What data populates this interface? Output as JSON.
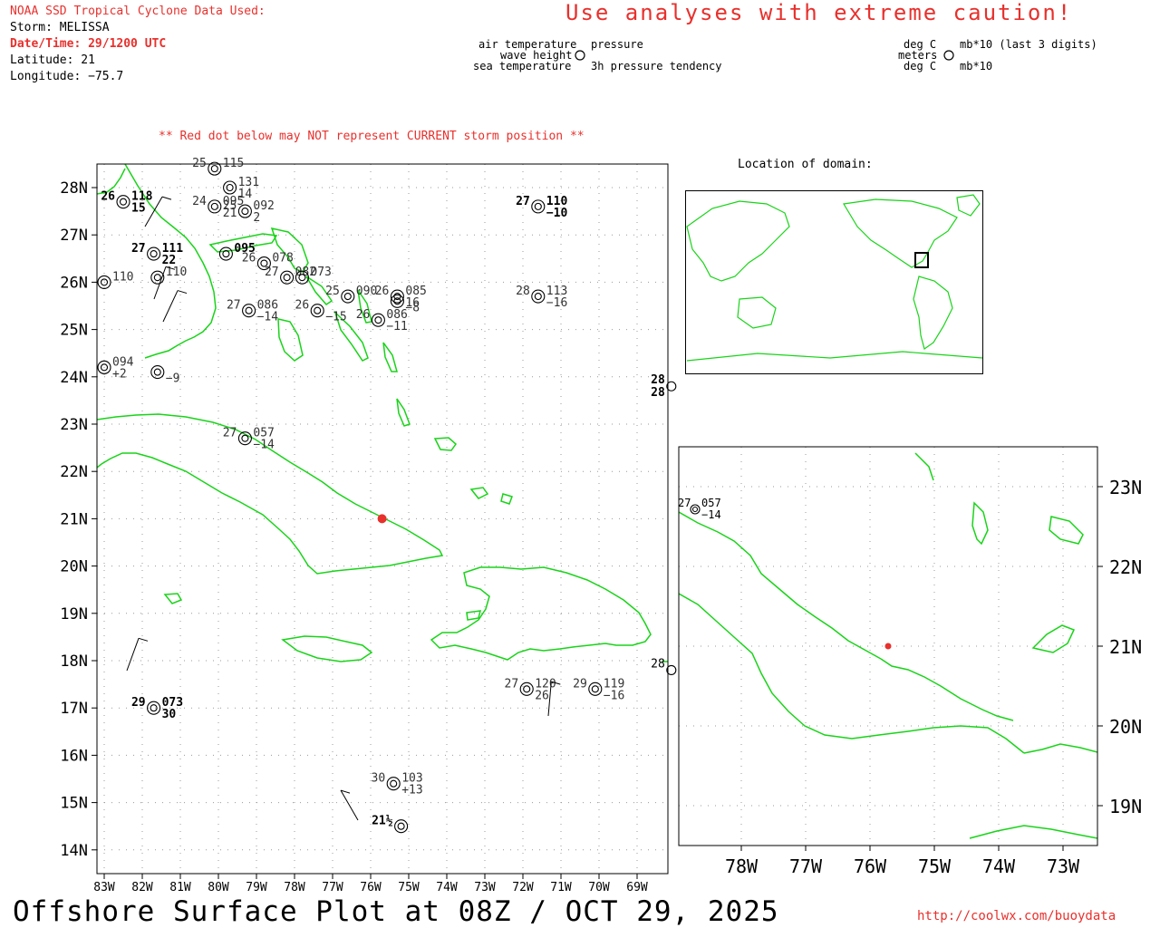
{
  "header": {
    "source": "NOAA SSD Tropical Cyclone Data Used:",
    "storm": "Storm: MELISSA",
    "datetime": "Date/Time: 29/1200 UTC",
    "latitude": "Latitude: 21",
    "longitude": "Longitude: −75.7",
    "caution": "Use analyses with extreme caution!",
    "red_dot_note": "** Red dot below may NOT represent CURRENT storm position **"
  },
  "legend": {
    "left": [
      "air temperature",
      "wave height",
      "sea temperature"
    ],
    "right": [
      "pressure",
      "3h pressure tendency"
    ],
    "units_left": [
      "deg C",
      "meters",
      "deg C"
    ],
    "units_right": [
      "mb*10 (last 3 digits)",
      "mb*10"
    ]
  },
  "main_map": {
    "lat_labels": [
      "28N",
      "27N",
      "26N",
      "25N",
      "24N",
      "23N",
      "22N",
      "21N",
      "20N",
      "19N",
      "18N",
      "17N",
      "16N",
      "15N",
      "14N"
    ],
    "lon_labels": [
      "83W",
      "82W",
      "81W",
      "80W",
      "79W",
      "78W",
      "77W",
      "76W",
      "75W",
      "74W",
      "73W",
      "72W",
      "71W",
      "70W",
      "69W"
    ],
    "stations": [
      {
        "lon": -71.6,
        "lat": 27.6,
        "t": "27",
        "p": "110",
        "tend": "−10",
        "bold": true
      },
      {
        "lon": -71.6,
        "lat": 25.7,
        "t": "28",
        "p": "113",
        "tend": "−16"
      },
      {
        "lon": -75.8,
        "lat": 25.2,
        "t": "26",
        "p": "086",
        "tend": "−11"
      },
      {
        "lon": -77.4,
        "lat": 25.4,
        "t": "26",
        "p": "",
        "tend": "−15"
      },
      {
        "lon": -79.2,
        "lat": 25.4,
        "t": "27",
        "p": "086",
        "tend": "−14"
      },
      {
        "lon": -79.3,
        "lat": 22.7,
        "t": "27",
        "p": "057",
        "tend": "−14"
      },
      {
        "lon": -70.1,
        "lat": 17.4,
        "t": "29",
        "p": "119",
        "tend": "−16"
      },
      {
        "lon": -71.9,
        "lat": 17.4,
        "t": "27",
        "p": "120",
        "tend": "26"
      },
      {
        "lon": -75.4,
        "lat": 15.4,
        "t": "30",
        "p": "103",
        "tend": "+13"
      },
      {
        "lon": -75.2,
        "lat": 14.5,
        "t": "21½",
        "p": "",
        "tend": "",
        "bold": true
      },
      {
        "lon": -81.7,
        "lat": 17.0,
        "t": "29",
        "p": "073",
        "tend": "30",
        "bold": true
      },
      {
        "lon": -83.0,
        "lat": 26.0,
        "t": "",
        "p": "110",
        "tend": ""
      },
      {
        "lon": -83.0,
        "lat": 24.2,
        "t": "",
        "p": "094",
        "tend": "+2"
      },
      {
        "lon": -81.6,
        "lat": 24.1,
        "t": "",
        "p": "",
        "tend": "−9"
      },
      {
        "lon": -81.7,
        "lat": 26.6,
        "t": "27",
        "p": "111",
        "tend": "22",
        "bold": true
      },
      {
        "lon": -81.6,
        "lat": 26.1,
        "t": "",
        "p": "110",
        "tend": ""
      },
      {
        "lon": -80.1,
        "lat": 27.6,
        "t": "24",
        "p": "095",
        "tend": "21"
      },
      {
        "lon": -79.3,
        "lat": 27.5,
        "t": "25",
        "p": "092",
        "tend": "2"
      },
      {
        "lon": -79.8,
        "lat": 26.6,
        "t": "",
        "p": "095",
        "tend": "",
        "bold": true
      },
      {
        "lon": -78.8,
        "lat": 26.4,
        "t": "26",
        "p": "078",
        "tend": ""
      },
      {
        "lon": -78.2,
        "lat": 26.1,
        "t": "27",
        "p": "082",
        "tend": ""
      },
      {
        "lon": -77.8,
        "lat": 26.1,
        "t": "",
        "p": "073",
        "tend": ""
      },
      {
        "lon": -76.6,
        "lat": 25.7,
        "t": "25",
        "p": "090",
        "tend": ""
      },
      {
        "lon": -75.3,
        "lat": 25.7,
        "t": "26",
        "p": "085",
        "tend": "16"
      },
      {
        "lon": -75.3,
        "lat": 25.6,
        "t": "",
        "p": "",
        "tend": "−8"
      },
      {
        "lon": -80.1,
        "lat": 28.4,
        "t": "25",
        "p": "115",
        "tend": ""
      },
      {
        "lon": -79.7,
        "lat": 28.0,
        "t": "",
        "p": "131",
        "tend": "14"
      },
      {
        "lon": -82.5,
        "lat": 27.7,
        "t": "26",
        "p": "118",
        "tend": "15",
        "bold": true
      }
    ],
    "buoys_edge": [
      {
        "lon": -68.1,
        "lat": 23.8,
        "t": "28",
        "tend": "28",
        "bold": true
      },
      {
        "lon": -68.1,
        "lat": 17.8,
        "t": "28",
        "tend": ""
      }
    ],
    "storm_dot": {
      "lon": -75.7,
      "lat": 21.0
    }
  },
  "locator": {
    "title": "Location of domain:"
  },
  "inset": {
    "lat_labels": [
      "23N",
      "22N",
      "21N",
      "20N",
      "19N"
    ],
    "lon_labels": [
      "78W",
      "77W",
      "76W",
      "75W",
      "74W",
      "73W"
    ],
    "station": {
      "t": "27",
      "p": "057",
      "tend": "−14"
    }
  },
  "footer": {
    "banner": "Offshore Surface Plot at 08Z / OCT 29, 2025",
    "url": "http://coolwx.com/buoydata"
  },
  "colors": {
    "land": "#18d418",
    "accent": "#e8302c",
    "grid": "#999999"
  }
}
